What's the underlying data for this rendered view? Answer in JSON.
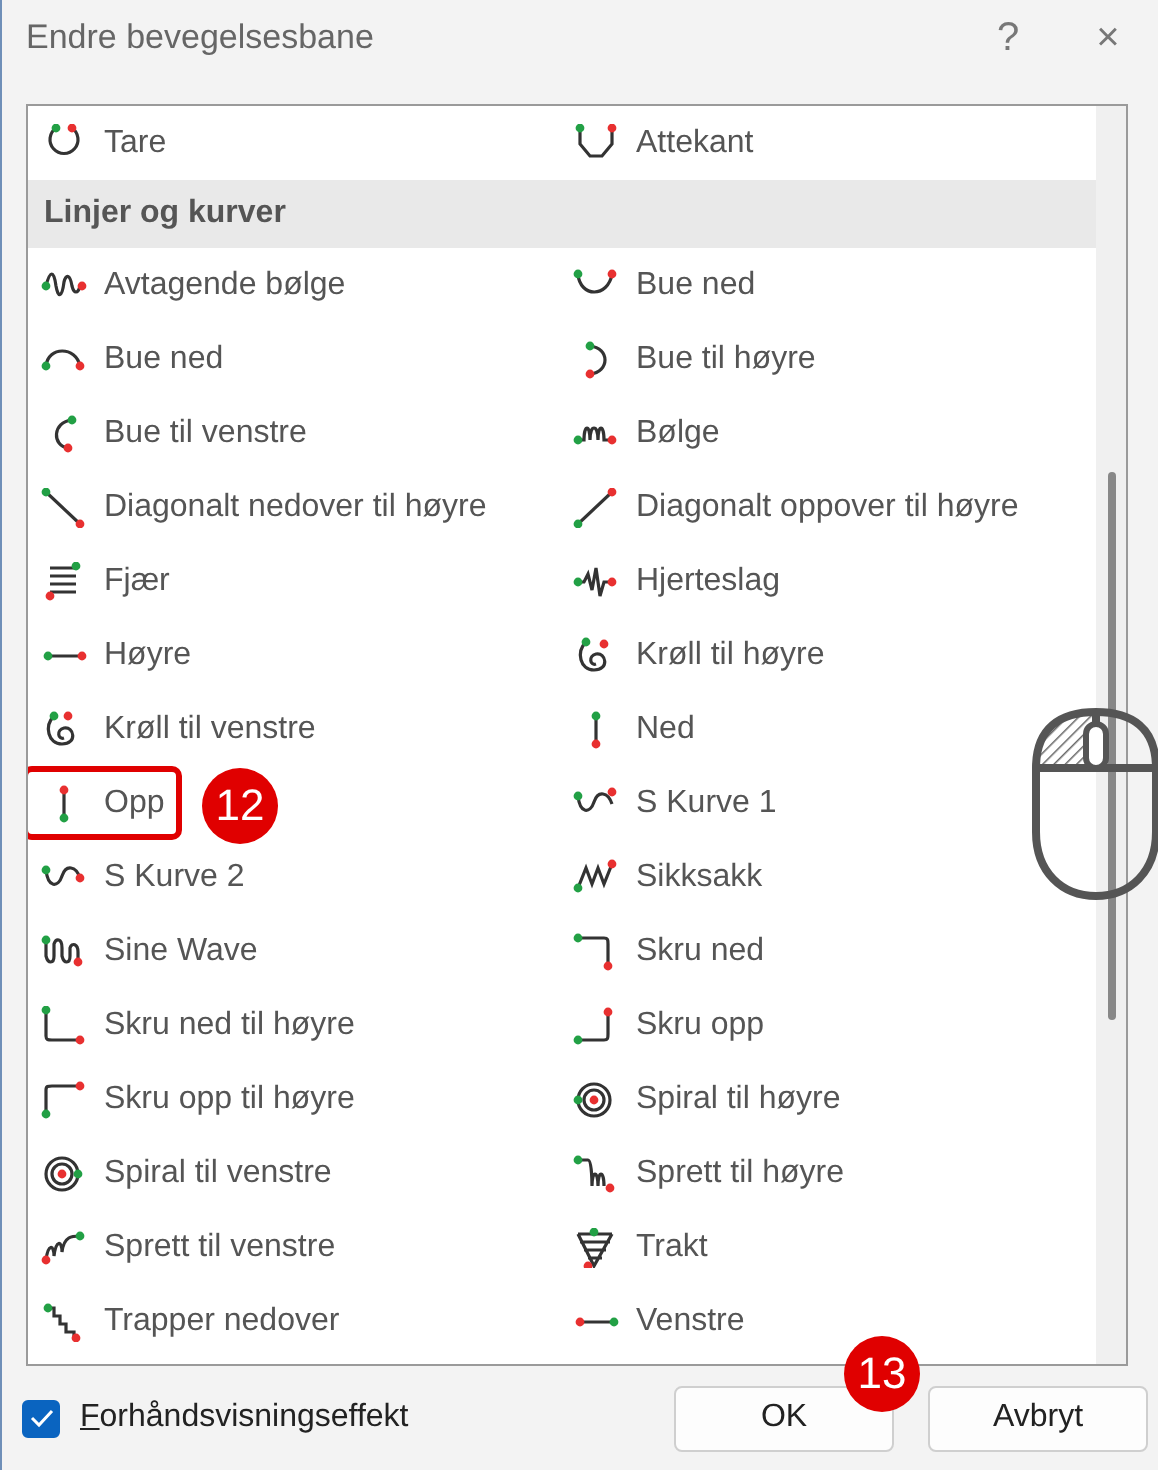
{
  "window": {
    "title": "Endre bevegelsesbane",
    "help": "?",
    "close": "×"
  },
  "list": {
    "sections": [
      {
        "rows": [
          {
            "cells": [
              {
                "label": "Tare",
                "selected": false
              },
              {
                "label": "Attekant",
                "selected": false
              }
            ]
          }
        ]
      },
      {
        "header": "Linjer og kurver",
        "rows": [
          {
            "cells": [
              {
                "label": "Avtagende bølge",
                "selected": false
              },
              {
                "label": "Bue ned",
                "selected": false
              }
            ]
          },
          {
            "cells": [
              {
                "label": "Bue ned",
                "selected": false
              },
              {
                "label": "Bue til høyre",
                "selected": false
              }
            ]
          },
          {
            "cells": [
              {
                "label": "Bue til venstre",
                "selected": false
              },
              {
                "label": "Bølge",
                "selected": false
              }
            ]
          },
          {
            "cells": [
              {
                "label": "Diagonalt nedover til høyre",
                "selected": false
              },
              {
                "label": "Diagonalt oppover til høyre",
                "selected": false
              }
            ]
          },
          {
            "cells": [
              {
                "label": "Fjær",
                "selected": false
              },
              {
                "label": "Hjerteslag",
                "selected": false
              }
            ]
          },
          {
            "cells": [
              {
                "label": "Høyre",
                "selected": false
              },
              {
                "label": "Krøll til høyre",
                "selected": false
              }
            ]
          },
          {
            "cells": [
              {
                "label": "Krøll til venstre",
                "selected": false
              },
              {
                "label": "Ned",
                "selected": false
              }
            ]
          },
          {
            "cells": [
              {
                "label": "Opp",
                "selected": false,
                "callout": "12"
              },
              {
                "label": "S Kurve 1",
                "selected": false
              }
            ]
          },
          {
            "cells": [
              {
                "label": "S Kurve 2",
                "selected": false
              },
              {
                "label": "Sikksakk",
                "selected": false
              }
            ]
          },
          {
            "cells": [
              {
                "label": "Sine Wave",
                "selected": false
              },
              {
                "label": "Skru ned",
                "selected": false
              }
            ]
          },
          {
            "cells": [
              {
                "label": "Skru ned til høyre",
                "selected": false
              },
              {
                "label": "Skru opp",
                "selected": false
              }
            ]
          },
          {
            "cells": [
              {
                "label": "Skru opp til høyre",
                "selected": false
              },
              {
                "label": "Spiral til høyre",
                "selected": false
              }
            ]
          },
          {
            "cells": [
              {
                "label": "Spiral til venstre",
                "selected": false
              },
              {
                "label": "Sprett til høyre",
                "selected": false
              }
            ]
          },
          {
            "cells": [
              {
                "label": "Sprett til venstre",
                "selected": false
              },
              {
                "label": "Trakt",
                "selected": false
              }
            ]
          },
          {
            "cells": [
              {
                "label": "Trapper nedover",
                "selected": false
              },
              {
                "label": "Venstre",
                "selected": false
              }
            ]
          }
        ]
      }
    ]
  },
  "preview": {
    "label": "Forhåndsvisningseffekt",
    "checked": true
  },
  "buttons": [
    {
      "label": "OK",
      "callout": "13"
    },
    {
      "label": "Avbryt"
    }
  ]
}
